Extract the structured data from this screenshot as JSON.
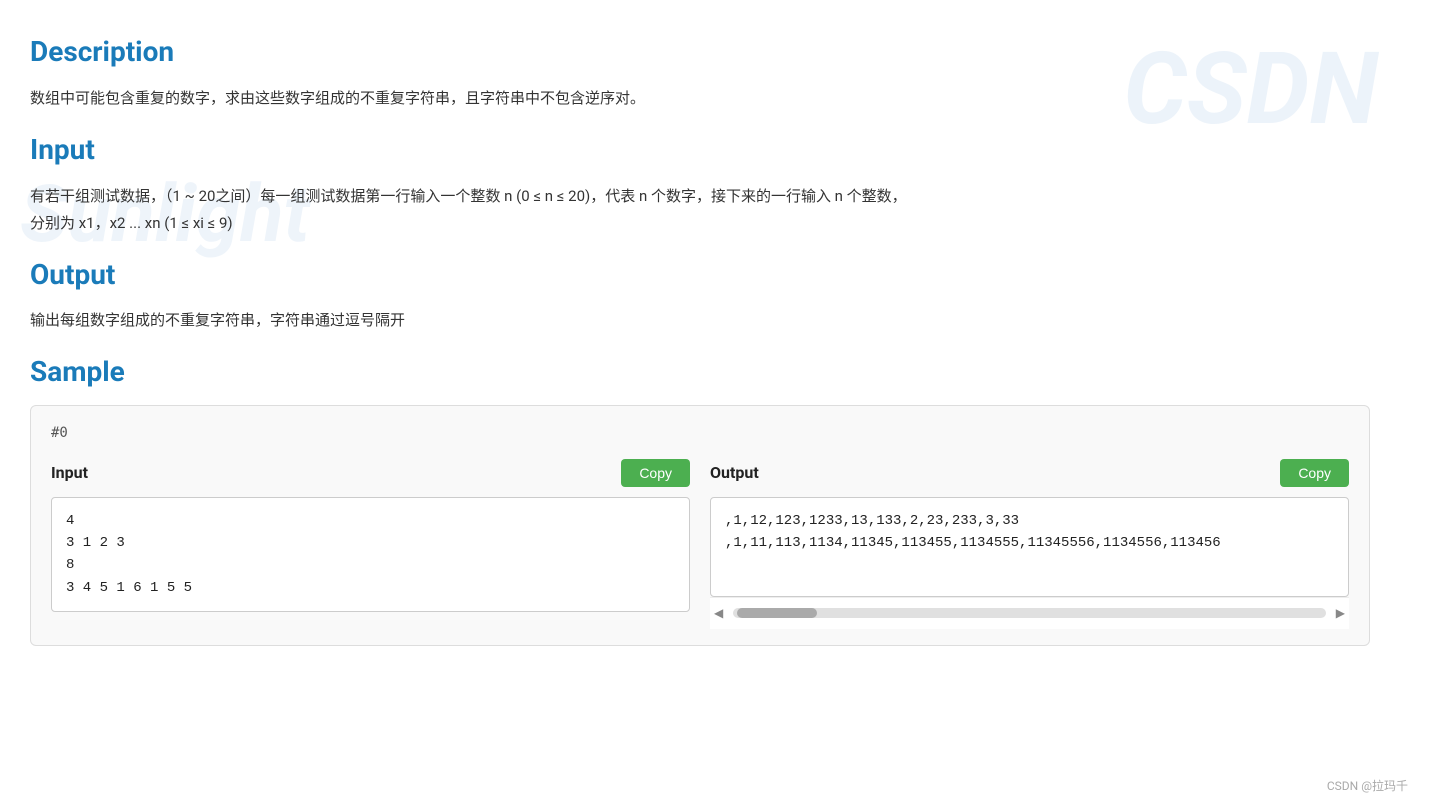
{
  "watermark": {
    "text1": "CSDN",
    "text2": "Sunlight",
    "text3": "❤"
  },
  "description": {
    "title": "Description",
    "content": "数组中可能包含重复的数字，求由这些数字组成的不重复字符串，且字符串中不包含逆序对。"
  },
  "input_section": {
    "title": "Input",
    "content_line1": "有若干组测试数据，（1 ~ 20之间）每一组测试数据第一行输入一个整数 n (0 ≤ n ≤ 20)，代表 n 个数字，接下来的一行输入 n 个整数，",
    "content_line2": "分别为 x1，x2 ... xn (1 ≤ xi ≤ 9)"
  },
  "output_section": {
    "title": "Output",
    "content": "输出每组数字组成的不重复字符串，字符串通过逗号隔开"
  },
  "sample_section": {
    "title": "Sample",
    "sample_number": "#0",
    "input_label": "Input",
    "output_label": "Output",
    "copy_label": "Copy",
    "input_code": "4\n3 1 2 3\n8\n3 4 5 1 6 1 5 5",
    "output_code": ",1,12,123,1233,13,133,2,23,233,3,33\n,1,11,113,1134,11345,113455,1134555,11345556,1134556,113456"
  },
  "footer": {
    "label": "CSDN @拉玛千"
  }
}
